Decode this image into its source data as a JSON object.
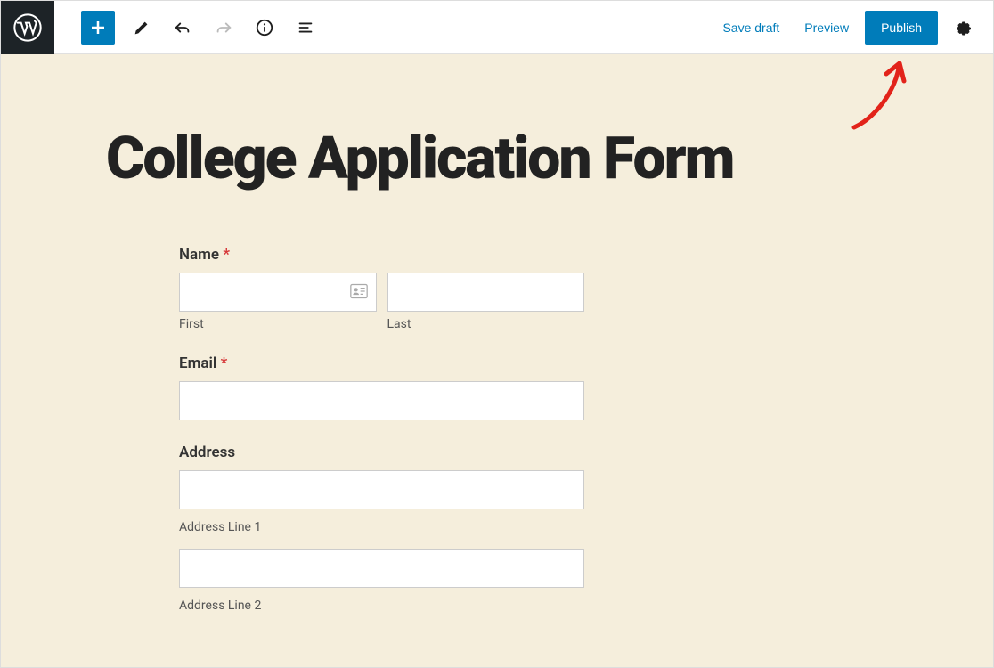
{
  "toolbar": {
    "save_draft": "Save draft",
    "preview": "Preview",
    "publish": "Publish"
  },
  "page": {
    "title": "College Application Form"
  },
  "form": {
    "name": {
      "label": "Name",
      "required": "*",
      "first_sub": "First",
      "last_sub": "Last"
    },
    "email": {
      "label": "Email",
      "required": "*"
    },
    "address": {
      "label": "Address",
      "line1_sub": "Address Line 1",
      "line2_sub": "Address Line 2"
    }
  }
}
